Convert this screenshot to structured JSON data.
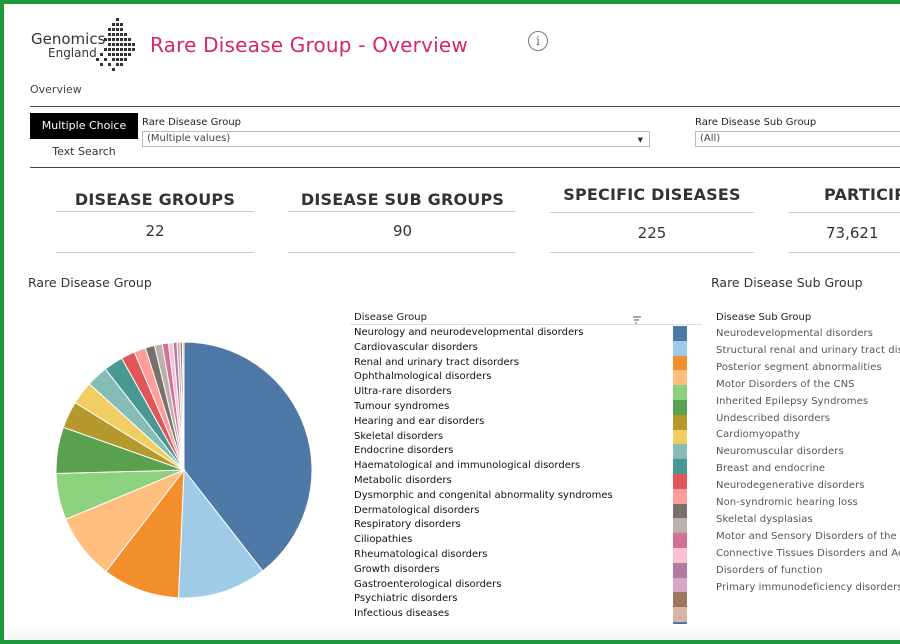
{
  "app": {
    "logo_line1": "Genomics",
    "logo_line2": "England",
    "title": "Rare Disease Group - Overview",
    "info_icon": "i",
    "overview_tab": "Overview"
  },
  "filters": {
    "mode_buttons": [
      "Multiple Choice",
      "Text Search"
    ],
    "group_label": "Rare Disease Group",
    "group_value": "(Multiple values)",
    "subgroup_label": "Rare Disease Sub Group",
    "subgroup_value": "(All)"
  },
  "kpis": [
    {
      "label": "DISEASE GROUPS",
      "value": "22"
    },
    {
      "label": "DISEASE SUB GROUPS",
      "value": "90"
    },
    {
      "label": "SPECIFIC DISEASES",
      "value": "225"
    },
    {
      "label": "PARTICIPA",
      "value": "73,621"
    }
  ],
  "group_section": {
    "title": "Rare Disease Group",
    "legend_header": "Disease Group",
    "sort_icon": "sort-icon",
    "items": [
      "Neurology and neurodevelopmental disorders",
      "Cardiovascular disorders",
      "Renal and urinary tract disorders",
      "Ophthalmological disorders",
      "Ultra-rare disorders",
      "Tumour syndromes",
      "Hearing and ear disorders",
      "Skeletal disorders",
      "Endocrine disorders",
      "Haematological and immunological disorders",
      "Metabolic disorders",
      "Dysmorphic and congenital abnormality syndromes",
      "Dermatological disorders",
      "Respiratory disorders",
      "Ciliopathies",
      "Rheumatological disorders",
      "Growth disorders",
      "Gastroenterological disorders",
      "Psychiatric disorders",
      "Infectious diseases"
    ],
    "colors": [
      "#4e79a7",
      "#a0cbe8",
      "#f28e2b",
      "#ffbe7d",
      "#8cd17d",
      "#59a14f",
      "#b6992d",
      "#f1ce63",
      "#86bcb6",
      "#499894",
      "#e15759",
      "#ff9d9a",
      "#79706e",
      "#bab0ac",
      "#d37295",
      "#fabfd2",
      "#b07aa1",
      "#d4a6c8",
      "#9d7660",
      "#d7b5a6",
      "#4e79a7"
    ]
  },
  "subgroup_section": {
    "title": "Rare Disease Sub Group",
    "legend_header": "Disease Sub Group",
    "items": [
      "Neurodevelopmental disorders",
      "Structural renal and urinary tract diseas",
      "Posterior segment abnormalities",
      "Motor Disorders of the CNS",
      "Inherited Epilepsy Syndromes",
      "Undescribed disorders",
      "Cardiomyopathy",
      "Neuromuscular disorders",
      "Breast and endocrine",
      "Neurodegenerative disorders",
      "Non-syndromic hearing loss",
      "Skeletal dysplasias",
      "Motor and Sensory Disorders of the PNS",
      "Connective Tissues Disorders and Aorto",
      "Disorders of function",
      "Primary immunodeficiency disorders"
    ]
  },
  "chart_data": {
    "type": "pie",
    "title": "Rare Disease Group",
    "categories": [
      "Neurology and neurodevelopmental disorders",
      "Cardiovascular disorders",
      "Renal and urinary tract disorders",
      "Ophthalmological disorders",
      "Ultra-rare disorders",
      "Tumour syndromes",
      "Hearing and ear disorders",
      "Skeletal disorders",
      "Endocrine disorders",
      "Haematological and immunological disorders",
      "Metabolic disorders",
      "Dysmorphic and congenital abnormality syndromes",
      "Dermatological disorders",
      "Respiratory disorders",
      "Ciliopathies",
      "Rheumatological disorders",
      "Growth disorders",
      "Gastroenterological disorders",
      "Psychiatric disorders",
      "Infectious diseases"
    ],
    "values": [
      40.5,
      11.5,
      10.0,
      8.5,
      6.0,
      6.0,
      3.5,
      3.0,
      2.8,
      2.5,
      1.8,
      1.5,
      1.2,
      1.0,
      0.8,
      0.6,
      0.5,
      0.4,
      0.3,
      0.2
    ],
    "legend": "right"
  }
}
